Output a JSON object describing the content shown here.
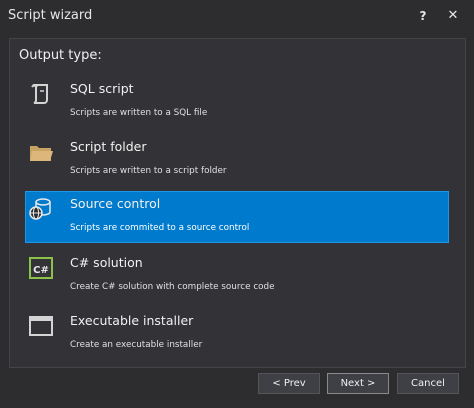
{
  "window": {
    "title": "Script wizard",
    "help_label": "?",
    "close_label": "✕"
  },
  "output_type_label": "Output type:",
  "options": [
    {
      "title": "SQL script",
      "description": "Scripts are written to a SQL file",
      "icon": "sql-script-icon",
      "selected": false
    },
    {
      "title": "Script folder",
      "description": "Scripts are written to a script folder",
      "icon": "folder-icon",
      "selected": false
    },
    {
      "title": "Source control",
      "description": "Scripts are commited to a source control",
      "icon": "source-control-icon",
      "selected": true
    },
    {
      "title": "C# solution",
      "description": "Create C# solution with complete source code",
      "icon": "csharp-icon",
      "selected": false
    },
    {
      "title": "Executable installer",
      "description": "Create an executable installer",
      "icon": "installer-icon",
      "selected": false
    }
  ],
  "csharp_icon_text": "C#",
  "buttons": {
    "prev": "< Prev",
    "next": "Next >",
    "cancel": "Cancel"
  },
  "colors": {
    "selected_background": "#007acc",
    "window_background": "#2d2d30",
    "folder_icon": "#dcb67a",
    "csharp_icon": "#8bc34a"
  }
}
